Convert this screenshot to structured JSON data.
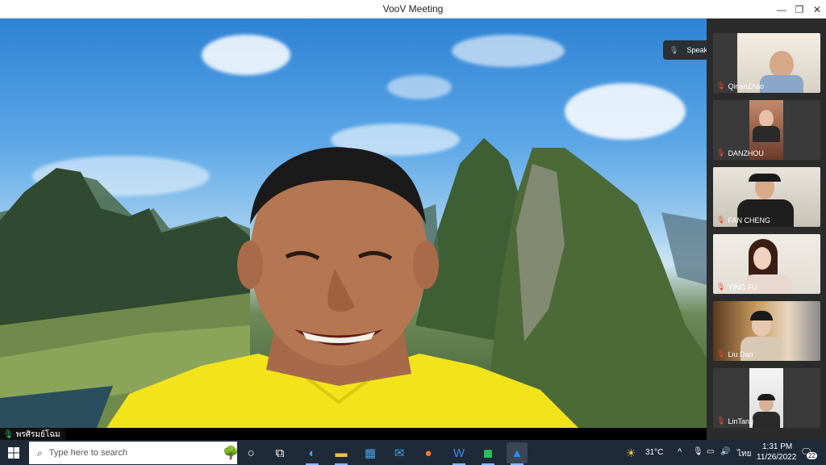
{
  "window": {
    "title": "VooV Meeting"
  },
  "stage": {
    "active_speaker_name": "พรศิรมย์โฉม"
  },
  "speaking_pill": {
    "label": "Speaking: พรศิรมย์โฉม;"
  },
  "participants": [
    {
      "name": "QinanZhao"
    },
    {
      "name": "DANZHOU"
    },
    {
      "name": "FAN CHENG"
    },
    {
      "name": "YING FU"
    },
    {
      "name": "Liu Dan"
    },
    {
      "name": "LinTang"
    }
  ],
  "taskbar": {
    "search_placeholder": "Type here to search",
    "weather": "31°C",
    "lang": "ไทย",
    "time": "1:31 PM",
    "date": "11/26/2022",
    "notifications": "22"
  },
  "colors": {
    "taskbar_bg": "#1f2a38",
    "sidebar_bg": "#2b2b2b",
    "mic_active": "#2ecc71",
    "mic_muted": "#e74c3c"
  }
}
